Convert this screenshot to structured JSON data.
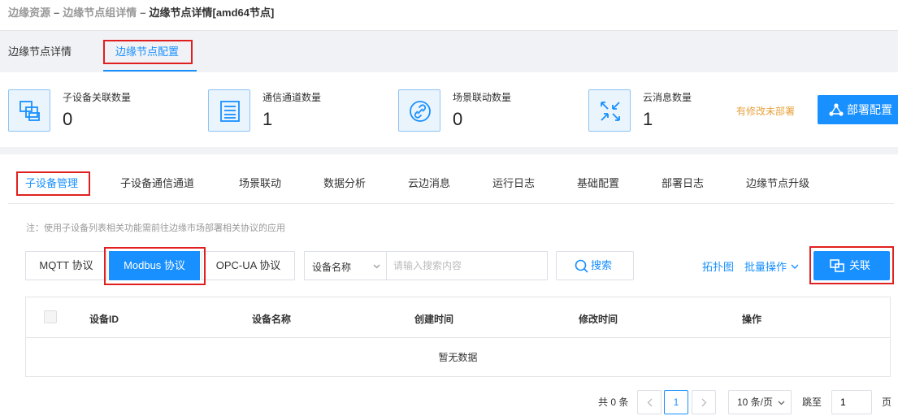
{
  "breadcrumb": {
    "items": [
      "边缘资源",
      "边缘节点组详情",
      "边缘节点详情[amd64节点]"
    ],
    "separator": "–"
  },
  "top_tabs": [
    {
      "label": "边缘节点详情",
      "active": false
    },
    {
      "label": "边缘节点配置",
      "active": true
    }
  ],
  "stats": [
    {
      "label": "子设备关联数量",
      "value": "0",
      "icon": "device-group-icon"
    },
    {
      "label": "通信通道数量",
      "value": "1",
      "icon": "channel-list-icon"
    },
    {
      "label": "场景联动数量",
      "value": "0",
      "icon": "link-icon"
    },
    {
      "label": "云消息数量",
      "value": "1",
      "icon": "arrows-icon"
    }
  ],
  "status": {
    "unsaved_text": "有修改未部署"
  },
  "deploy_button": {
    "label": "部署配置",
    "icon": "deploy-icon"
  },
  "sub_tabs": [
    {
      "label": "子设备管理",
      "active": true
    },
    {
      "label": "子设备通信通道",
      "active": false
    },
    {
      "label": "场景联动",
      "active": false
    },
    {
      "label": "数据分析",
      "active": false
    },
    {
      "label": "云边消息",
      "active": false
    },
    {
      "label": "运行日志",
      "active": false
    },
    {
      "label": "基础配置",
      "active": false
    },
    {
      "label": "部署日志",
      "active": false
    },
    {
      "label": "边缘节点升级",
      "active": false
    }
  ],
  "note": "注：使用子设备列表相关功能需前往边缘市场部署相关协议的应用",
  "protocols": [
    {
      "label": "MQTT 协议",
      "active": false
    },
    {
      "label": "Modbus 协议",
      "active": true
    },
    {
      "label": "OPC-UA 协议",
      "active": false
    }
  ],
  "search": {
    "field_select": "设备名称",
    "placeholder": "请输入搜索内容",
    "value": "",
    "button_label": "搜索"
  },
  "actions": {
    "topology_label": "拓扑图",
    "batch_label": "批量操作",
    "associate_label": "关联"
  },
  "table": {
    "columns": [
      "设备ID",
      "设备名称",
      "创建时间",
      "修改时间",
      "操作"
    ],
    "rows": [],
    "empty_text": "暂无数据"
  },
  "pagination": {
    "total_text": "共 0 条",
    "current_page": "1",
    "page_size": "10 条/页",
    "jump_label": "跳至",
    "jump_value": "1",
    "page_unit": "页"
  },
  "colors": {
    "accent": "#1890ff",
    "warning": "#e6a23c",
    "highlight_box": "#e02020"
  }
}
